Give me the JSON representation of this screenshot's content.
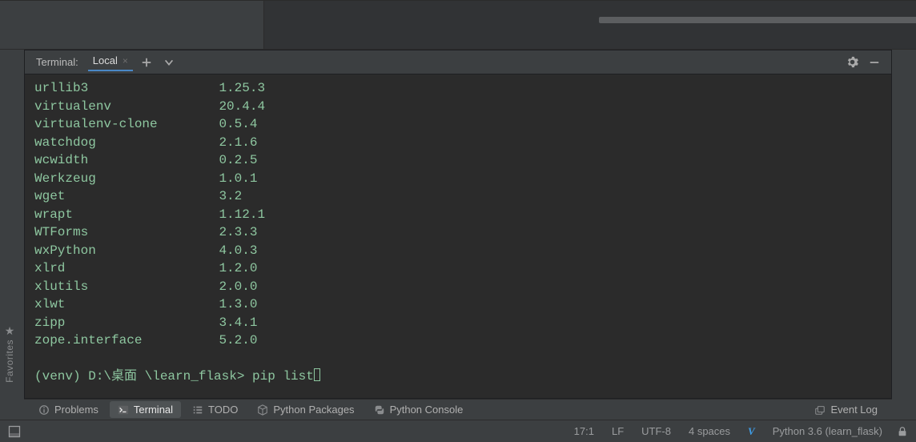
{
  "terminal": {
    "header_title": "Terminal:",
    "tab_label": "Local",
    "packages": [
      {
        "name": "urllib3",
        "version": "1.25.3"
      },
      {
        "name": "virtualenv",
        "version": "20.4.4"
      },
      {
        "name": "virtualenv-clone",
        "version": "0.5.4"
      },
      {
        "name": "watchdog",
        "version": "2.1.6"
      },
      {
        "name": "wcwidth",
        "version": "0.2.5"
      },
      {
        "name": "Werkzeug",
        "version": "1.0.1"
      },
      {
        "name": "wget",
        "version": "3.2"
      },
      {
        "name": "wrapt",
        "version": "1.12.1"
      },
      {
        "name": "WTForms",
        "version": "2.3.3"
      },
      {
        "name": "wxPython",
        "version": "4.0.3"
      },
      {
        "name": "xlrd",
        "version": "1.2.0"
      },
      {
        "name": "xlutils",
        "version": "2.0.0"
      },
      {
        "name": "xlwt",
        "version": "1.3.0"
      },
      {
        "name": "zipp",
        "version": "3.4.1"
      },
      {
        "name": "zope.interface",
        "version": "5.2.0"
      }
    ],
    "prompt": "(venv) D:\\桌面 \\learn_flask> pip list"
  },
  "toolbar": {
    "problems": "Problems",
    "terminal": "Terminal",
    "todo": "TODO",
    "python_packages": "Python Packages",
    "python_console": "Python Console",
    "event_log": "Event Log"
  },
  "status": {
    "pos": "17:1",
    "line_ending": "LF",
    "encoding": "UTF-8",
    "indent": "4 spaces",
    "interpreter": "Python 3.6 (learn_flask)"
  },
  "side": {
    "favorites": "Favorites"
  }
}
